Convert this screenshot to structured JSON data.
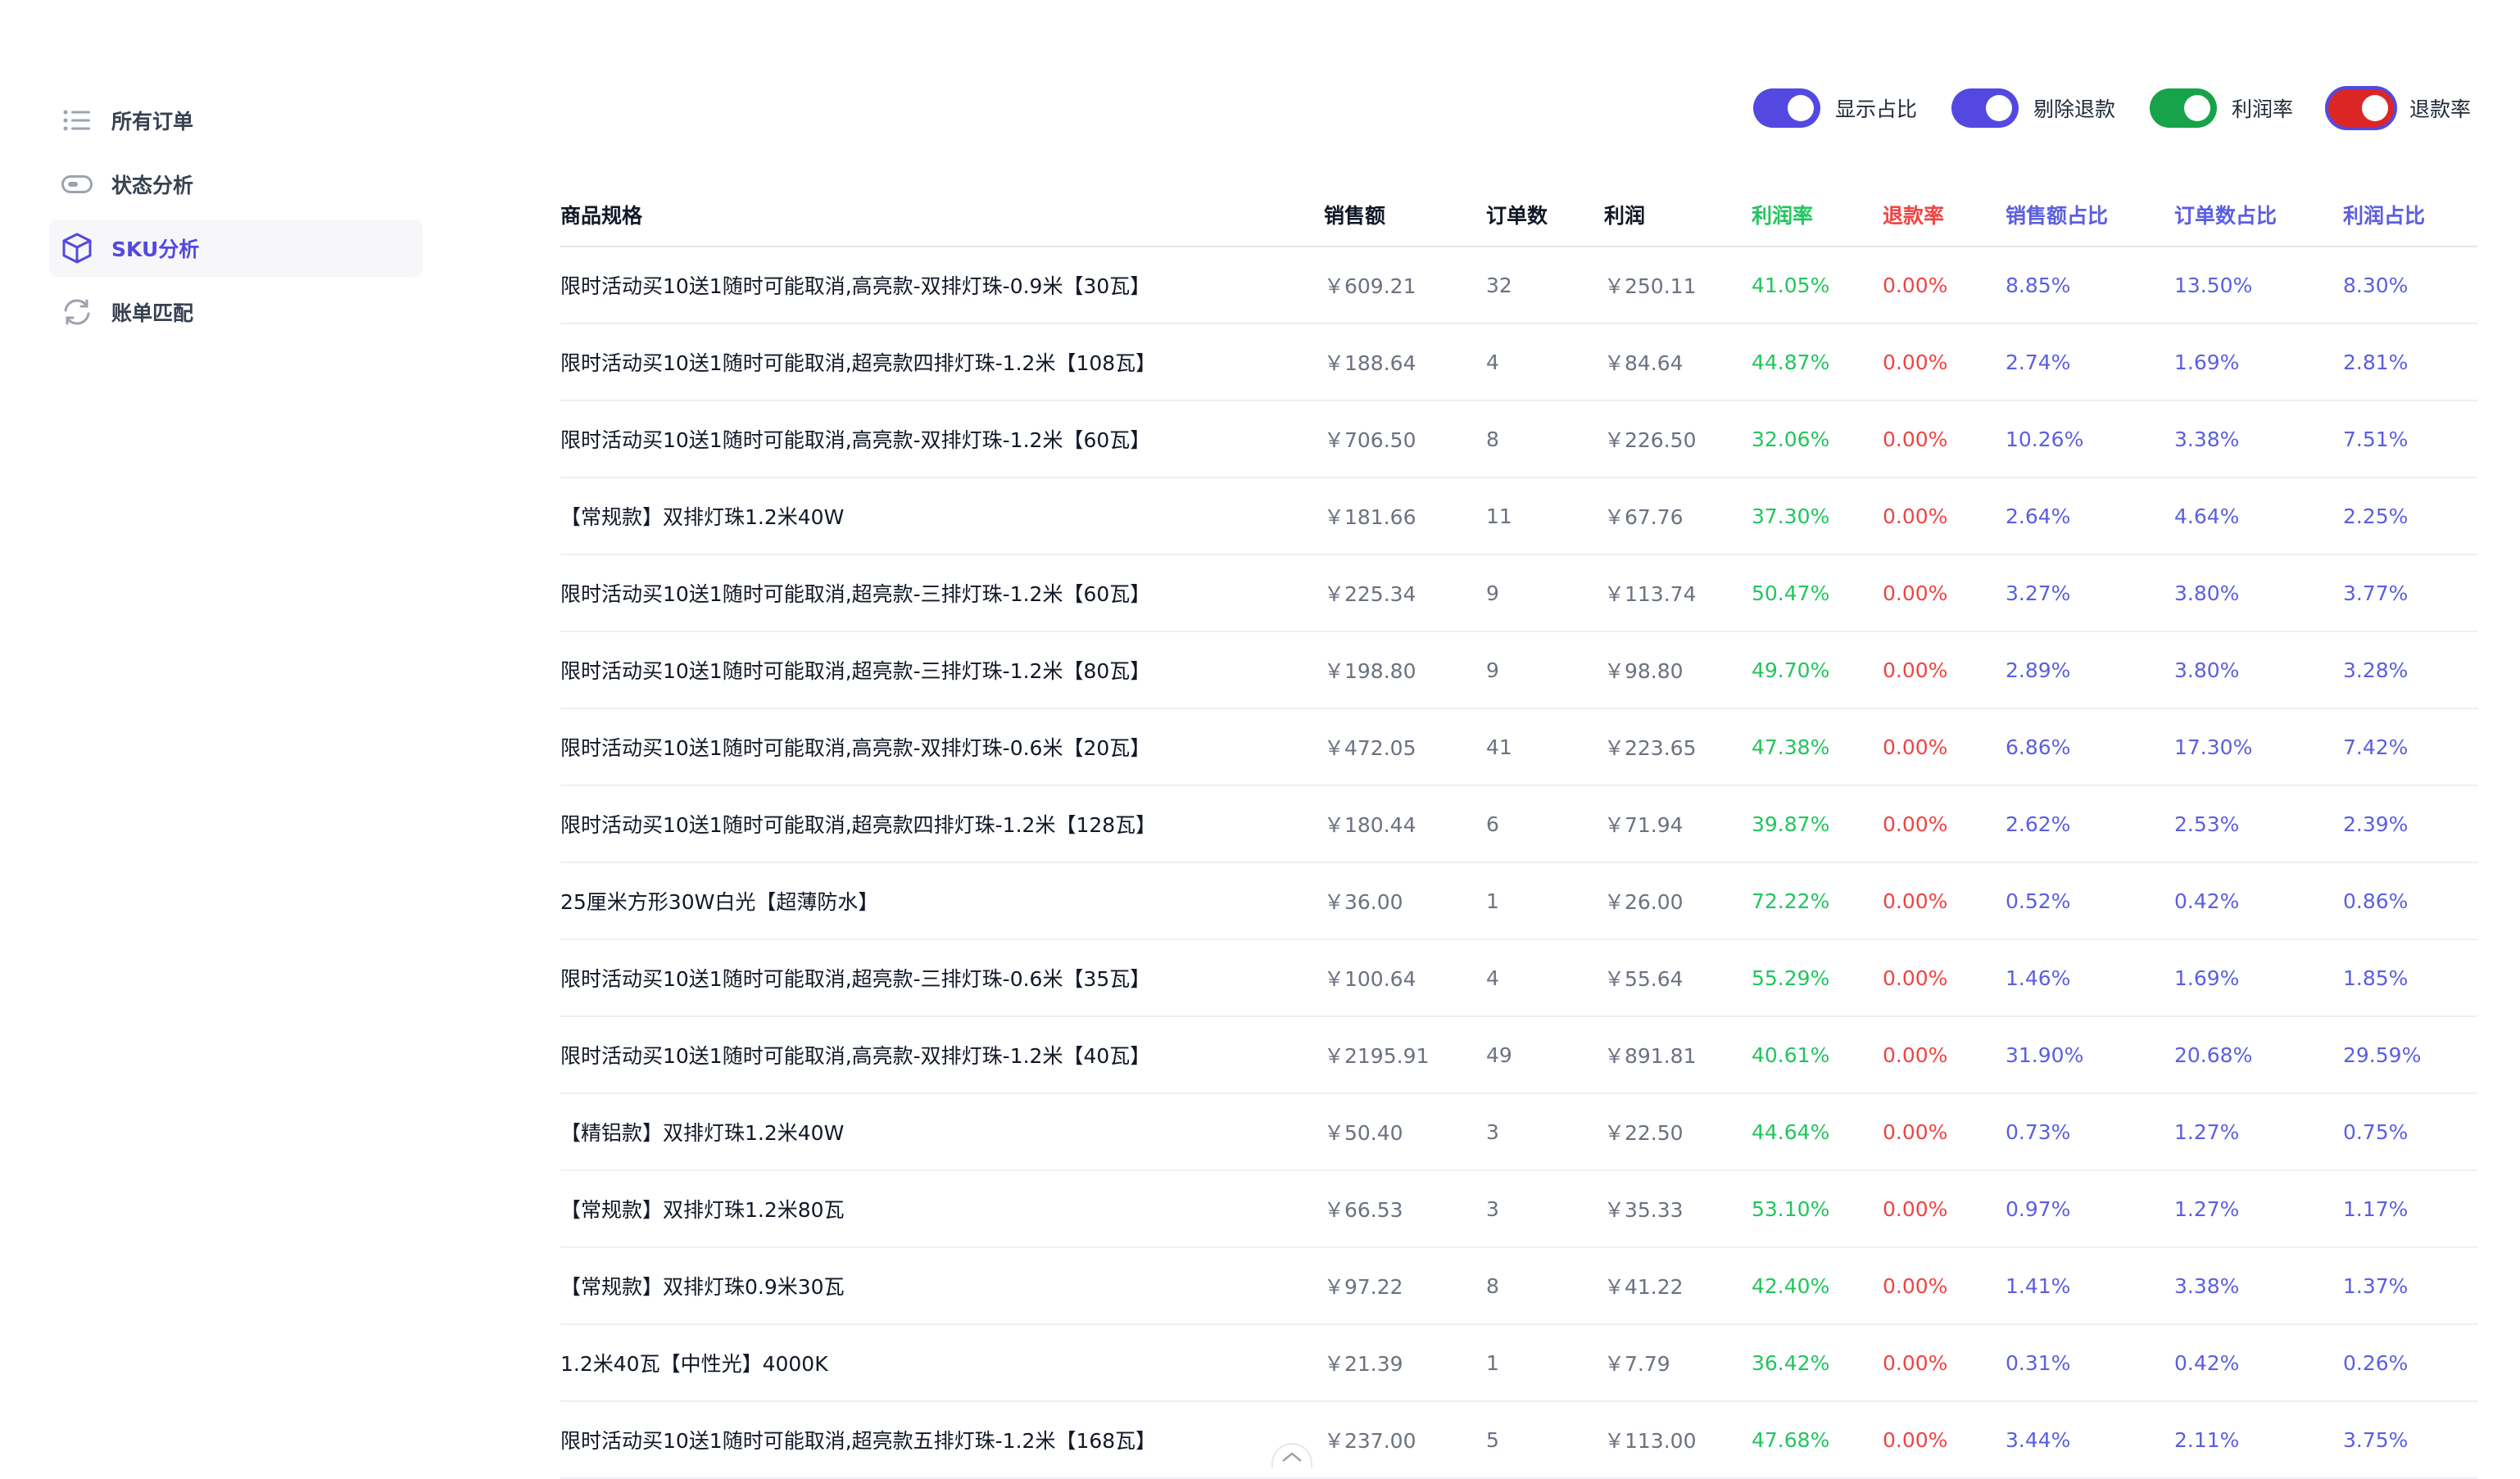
{
  "sidebar": {
    "items": [
      {
        "label": "所有订单",
        "icon": "list-icon",
        "active": false
      },
      {
        "label": "状态分析",
        "icon": "toggle-icon",
        "active": false
      },
      {
        "label": "SKU分析",
        "icon": "cube-icon",
        "active": true
      },
      {
        "label": "账单匹配",
        "icon": "refresh-icon",
        "active": false
      }
    ]
  },
  "toggles": [
    {
      "label": "显示占比",
      "on": true,
      "color": "#5349e0"
    },
    {
      "label": "剔除退款",
      "on": true,
      "color": "#5349e0"
    },
    {
      "label": "利润率",
      "on": true,
      "color": "#16a34a"
    },
    {
      "label": "退款率",
      "on": true,
      "color": "#dc2626",
      "focused": true
    }
  ],
  "table": {
    "headers": [
      "商品规格",
      "销售额",
      "订单数",
      "利润",
      "利润率",
      "退款率",
      "销售额占比",
      "订单数占比",
      "利润占比"
    ],
    "rows": [
      [
        "限时活动买10送1随时可能取消,高亮款-双排灯珠-0.9米【30瓦】",
        "￥609.21",
        "32",
        "￥250.11",
        "41.05%",
        "0.00%",
        "8.85%",
        "13.50%",
        "8.30%"
      ],
      [
        "限时活动买10送1随时可能取消,超亮款四排灯珠-1.2米【108瓦】",
        "￥188.64",
        "4",
        "￥84.64",
        "44.87%",
        "0.00%",
        "2.74%",
        "1.69%",
        "2.81%"
      ],
      [
        "限时活动买10送1随时可能取消,高亮款-双排灯珠-1.2米【60瓦】",
        "￥706.50",
        "8",
        "￥226.50",
        "32.06%",
        "0.00%",
        "10.26%",
        "3.38%",
        "7.51%"
      ],
      [
        "【常规款】双排灯珠1.2米40W",
        "￥181.66",
        "11",
        "￥67.76",
        "37.30%",
        "0.00%",
        "2.64%",
        "4.64%",
        "2.25%"
      ],
      [
        "限时活动买10送1随时可能取消,超亮款-三排灯珠-1.2米【60瓦】",
        "￥225.34",
        "9",
        "￥113.74",
        "50.47%",
        "0.00%",
        "3.27%",
        "3.80%",
        "3.77%"
      ],
      [
        "限时活动买10送1随时可能取消,超亮款-三排灯珠-1.2米【80瓦】",
        "￥198.80",
        "9",
        "￥98.80",
        "49.70%",
        "0.00%",
        "2.89%",
        "3.80%",
        "3.28%"
      ],
      [
        "限时活动买10送1随时可能取消,高亮款-双排灯珠-0.6米【20瓦】",
        "￥472.05",
        "41",
        "￥223.65",
        "47.38%",
        "0.00%",
        "6.86%",
        "17.30%",
        "7.42%"
      ],
      [
        "限时活动买10送1随时可能取消,超亮款四排灯珠-1.2米【128瓦】",
        "￥180.44",
        "6",
        "￥71.94",
        "39.87%",
        "0.00%",
        "2.62%",
        "2.53%",
        "2.39%"
      ],
      [
        "25厘米方形30W白光【超薄防水】",
        "￥36.00",
        "1",
        "￥26.00",
        "72.22%",
        "0.00%",
        "0.52%",
        "0.42%",
        "0.86%"
      ],
      [
        "限时活动买10送1随时可能取消,超亮款-三排灯珠-0.6米【35瓦】",
        "￥100.64",
        "4",
        "￥55.64",
        "55.29%",
        "0.00%",
        "1.46%",
        "1.69%",
        "1.85%"
      ],
      [
        "限时活动买10送1随时可能取消,高亮款-双排灯珠-1.2米【40瓦】",
        "￥2195.91",
        "49",
        "￥891.81",
        "40.61%",
        "0.00%",
        "31.90%",
        "20.68%",
        "29.59%"
      ],
      [
        "【精铝款】双排灯珠1.2米40W",
        "￥50.40",
        "3",
        "￥22.50",
        "44.64%",
        "0.00%",
        "0.73%",
        "1.27%",
        "0.75%"
      ],
      [
        "【常规款】双排灯珠1.2米80瓦",
        "￥66.53",
        "3",
        "￥35.33",
        "53.10%",
        "0.00%",
        "0.97%",
        "1.27%",
        "1.17%"
      ],
      [
        "【常规款】双排灯珠0.9米30瓦",
        "￥97.22",
        "8",
        "￥41.22",
        "42.40%",
        "0.00%",
        "1.41%",
        "3.38%",
        "1.37%"
      ],
      [
        "1.2米40瓦【中性光】4000K",
        "￥21.39",
        "1",
        "￥7.79",
        "36.42%",
        "0.00%",
        "0.31%",
        "0.42%",
        "0.26%"
      ],
      [
        "限时活动买10送1随时可能取消,超亮款五排灯珠-1.2米【168瓦】",
        "￥237.00",
        "5",
        "￥113.00",
        "47.68%",
        "0.00%",
        "3.44%",
        "2.11%",
        "3.75%"
      ]
    ]
  }
}
